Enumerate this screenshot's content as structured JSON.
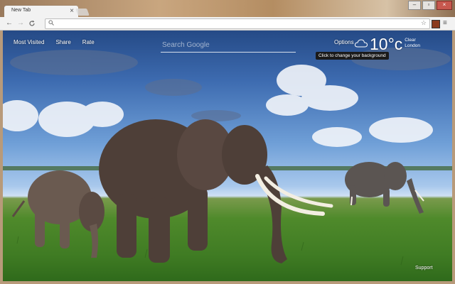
{
  "browser": {
    "tab_title": "New Tab",
    "tab_close": "×",
    "window_controls": [
      "–",
      "▫",
      "×"
    ],
    "nav": {
      "back": "←",
      "forward": "→",
      "reload": "C"
    },
    "omnibox_value": "",
    "omnibox_icon": "search-icon",
    "star_glyph": "☆",
    "menu_glyph": "≡"
  },
  "newtab": {
    "nav_links": [
      "Most Visited",
      "Share",
      "Rate"
    ],
    "search_placeholder": "Search Google",
    "options_label": "Options",
    "tooltip": "Click to change your background",
    "weather": {
      "temp": "10°c",
      "condition": "Clear",
      "location": "London",
      "icon": "cloud-icon"
    },
    "support_label": "Support"
  },
  "colors": {
    "toolbar": "#f2f2f2",
    "sky": "#3d6bb0",
    "grass": "#4f8a2b",
    "tooltip": "#1a1a1a"
  }
}
